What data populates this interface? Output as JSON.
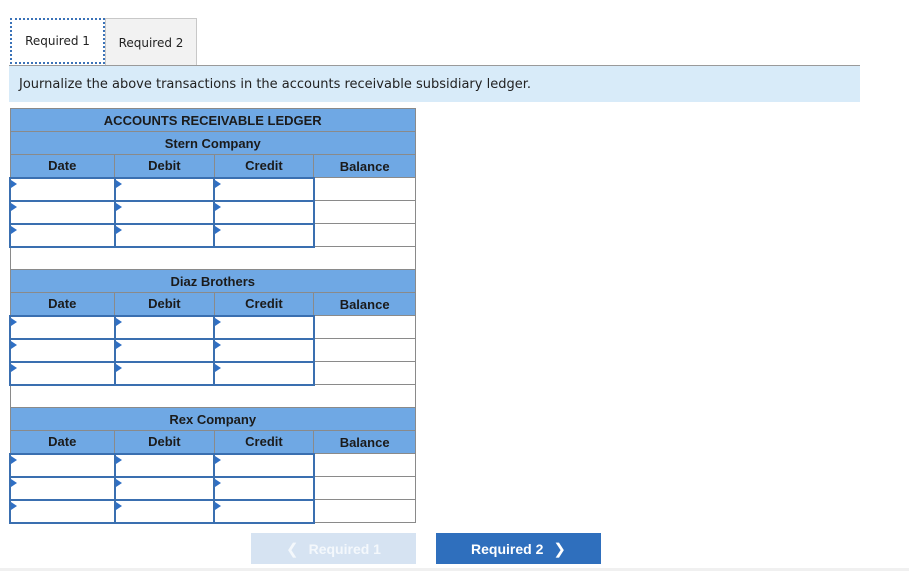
{
  "tabs": [
    {
      "label": "Required 1",
      "active": true
    },
    {
      "label": "Required 2",
      "active": false
    }
  ],
  "instruction": "Journalize the above transactions in the accounts receivable subsidiary ledger.",
  "ledger": {
    "title": "ACCOUNTS RECEIVABLE LEDGER",
    "columns": [
      "Date",
      "Debit",
      "Credit",
      "Balance"
    ],
    "accounts": [
      {
        "name": "Stern Company",
        "rows": [
          {
            "date": "",
            "debit": "",
            "credit": "",
            "balance": ""
          },
          {
            "date": "",
            "debit": "",
            "credit": "",
            "balance": ""
          },
          {
            "date": "",
            "debit": "",
            "credit": "",
            "balance": ""
          }
        ]
      },
      {
        "name": "Diaz Brothers",
        "rows": [
          {
            "date": "",
            "debit": "",
            "credit": "",
            "balance": ""
          },
          {
            "date": "",
            "debit": "",
            "credit": "",
            "balance": ""
          },
          {
            "date": "",
            "debit": "",
            "credit": "",
            "balance": ""
          }
        ]
      },
      {
        "name": "Rex Company",
        "rows": [
          {
            "date": "",
            "debit": "",
            "credit": "",
            "balance": ""
          },
          {
            "date": "",
            "debit": "",
            "credit": "",
            "balance": ""
          },
          {
            "date": "",
            "debit": "",
            "credit": "",
            "balance": ""
          }
        ]
      }
    ]
  },
  "nav": {
    "prev_label": "Required 1",
    "prev_icon": "chevron-left-icon",
    "prev_enabled": false,
    "next_label": "Required 2",
    "next_icon": "chevron-right-icon",
    "next_enabled": true
  },
  "colors": {
    "header_blue": "#6fa8e4",
    "instruction_bg": "#d8ebf9",
    "next_button": "#2f6fbd",
    "prev_button_disabled": "#d6e3f2",
    "input_border": "#3a6fb0"
  }
}
